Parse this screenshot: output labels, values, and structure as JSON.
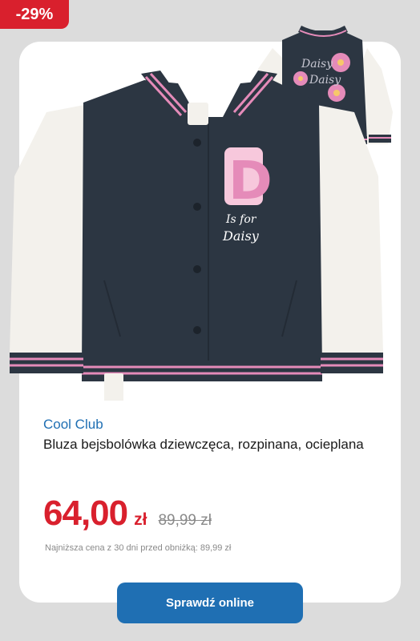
{
  "badge": {
    "discount": "-29%"
  },
  "product": {
    "brand": "Cool Club",
    "title": "Bluza bejsbolówka dziewczęca, rozpinana, ocieplana",
    "image_icon": "varsity-jacket-image",
    "patch_letter": "D",
    "patch_text_1": "Is for",
    "patch_text_2": "Daisy",
    "back_text_1": "Daisy",
    "back_text_2": "Daisy"
  },
  "price": {
    "current": "64,00",
    "currency": "zł",
    "old": "89,99 zł",
    "lowest_note": "Najniższa cena z 30 dni przed obniżką: 89,99 zł"
  },
  "cta": {
    "label": "Sprawdź online"
  },
  "colors": {
    "accent": "#1f6fb3",
    "sale": "#d9202d",
    "jacket": "#2c3642",
    "sleeve": "#f3f1ec",
    "pink": "#e58bb9"
  }
}
